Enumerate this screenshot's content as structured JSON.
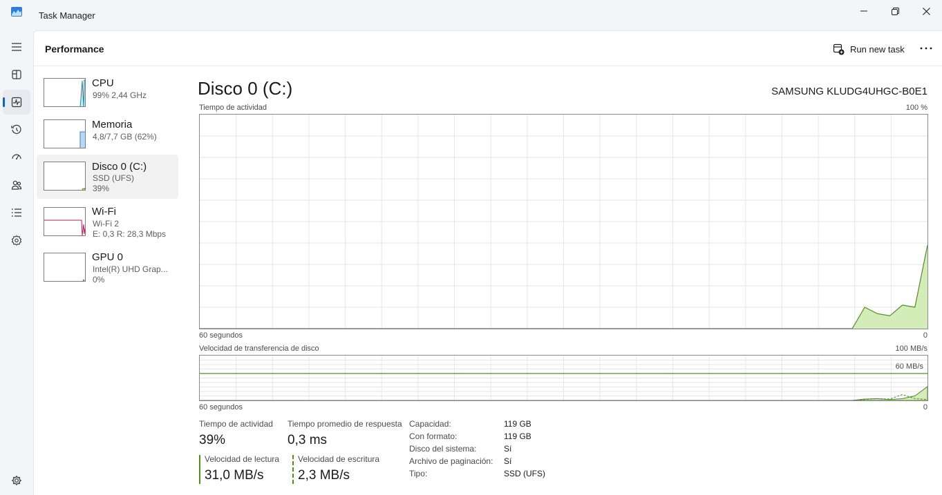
{
  "window": {
    "title": "Task Manager",
    "icons": {
      "app": "task-manager-icon",
      "minimize": "minimize-icon",
      "maximize": "maximize-icon",
      "close": "close-icon"
    }
  },
  "rail": {
    "items": [
      {
        "name": "hamburger-icon",
        "active": false
      },
      {
        "name": "processes-icon",
        "active": false
      },
      {
        "name": "performance-icon",
        "active": true
      },
      {
        "name": "app-history-icon",
        "active": false
      },
      {
        "name": "startup-apps-icon",
        "active": false
      },
      {
        "name": "users-icon",
        "active": false
      },
      {
        "name": "details-icon",
        "active": false
      },
      {
        "name": "services-icon",
        "active": false
      }
    ],
    "settings_icon": "settings-icon"
  },
  "header": {
    "title": "Performance",
    "run_task_label": "Run new task",
    "more_icon": "more-icon"
  },
  "devices": [
    {
      "name": "CPU",
      "line1": "99%  2,44 GHz",
      "line2": "",
      "selected": false
    },
    {
      "name": "Memoria",
      "line1": "4,8/7,7 GB (62%)",
      "line2": "",
      "selected": false
    },
    {
      "name": "Disco 0 (C:)",
      "line1": "SSD (UFS)",
      "line2": "39%",
      "selected": true
    },
    {
      "name": "Wi-Fi",
      "line1": "Wi-Fi 2",
      "line2": "E: 0,3  R: 28,3 Mbps",
      "selected": false
    },
    {
      "name": "GPU 0",
      "line1": "Intel(R) UHD Grap...",
      "line2": "0%",
      "selected": false
    }
  ],
  "detail": {
    "title": "Disco 0 (C:)",
    "model": "SAMSUNG KLUDG4UHGC-B0E1",
    "activity_graph": {
      "label": "Tiempo de actividad",
      "max_label": "100 %",
      "time_label": "60 segundos",
      "zero_label": "0",
      "max_value": 100,
      "values": [
        0,
        0,
        0,
        0,
        0,
        0,
        0,
        0,
        0,
        0,
        0,
        0,
        0,
        0,
        0,
        0,
        0,
        0,
        0,
        0,
        0,
        0,
        0,
        0,
        0,
        0,
        0,
        0,
        0,
        0,
        0,
        0,
        0,
        0,
        0,
        0,
        0,
        0,
        0,
        0,
        0,
        0,
        0,
        0,
        0,
        0,
        0,
        0,
        0,
        0,
        0,
        0,
        0,
        10,
        7,
        6,
        11,
        10,
        39
      ]
    },
    "transfer_graph": {
      "label": "Velocidad de transferencia de disco",
      "max_label": "100 MB/s",
      "line_label": "60 MB/s",
      "time_label": "60 segundos",
      "zero_label": "0",
      "max_value": 100,
      "reference_value": 60,
      "read_values": [
        0,
        0,
        0,
        0,
        0,
        0,
        0,
        0,
        0,
        0,
        0,
        0,
        0,
        0,
        0,
        0,
        0,
        0,
        0,
        0,
        0,
        0,
        0,
        0,
        0,
        0,
        0,
        0,
        0,
        0,
        0,
        0,
        0,
        0,
        0,
        0,
        0,
        0,
        0,
        0,
        0,
        0,
        0,
        0,
        0,
        0,
        0,
        0,
        0,
        0,
        0,
        0,
        0,
        3,
        4,
        2,
        4,
        10,
        31
      ],
      "write_values": [
        0,
        0,
        0,
        0,
        0,
        0,
        0,
        0,
        0,
        0,
        0,
        0,
        0,
        0,
        0,
        0,
        0,
        0,
        0,
        0,
        0,
        0,
        0,
        0,
        0,
        0,
        0,
        0,
        0,
        0,
        0,
        0,
        0,
        0,
        0,
        0,
        0,
        0,
        0,
        0,
        0,
        0,
        0,
        0,
        0,
        0,
        0,
        0,
        0,
        0,
        0,
        0,
        0,
        2,
        4,
        3,
        13,
        4,
        2
      ]
    },
    "stats": {
      "activity_label": "Tiempo de actividad",
      "activity_value": "39%",
      "response_label": "Tiempo promedio de respuesta",
      "response_value": "0,3 ms",
      "read_label": "Velocidad de lectura",
      "read_value": "31,0 MB/s",
      "write_label": "Velocidad de escritura",
      "write_value": "2,3 MB/s"
    },
    "properties": [
      {
        "key": "Capacidad:",
        "value": "119 GB"
      },
      {
        "key": "Con formato:",
        "value": "119 GB"
      },
      {
        "key": "Disco del sistema:",
        "value": "Sí"
      },
      {
        "key": "Archivo de paginación:",
        "value": "Sí"
      },
      {
        "key": "Tipo:",
        "value": "SSD (UFS)"
      }
    ]
  },
  "colors": {
    "disk_line": "#4e8f1e",
    "disk_fill": "#d3ecb8",
    "cpu": "#1b8aa6",
    "memory": "#3b7ed2",
    "wifi": "#c2185b",
    "gpu": "#7b4fc9",
    "grid": "#e6e6e6"
  }
}
